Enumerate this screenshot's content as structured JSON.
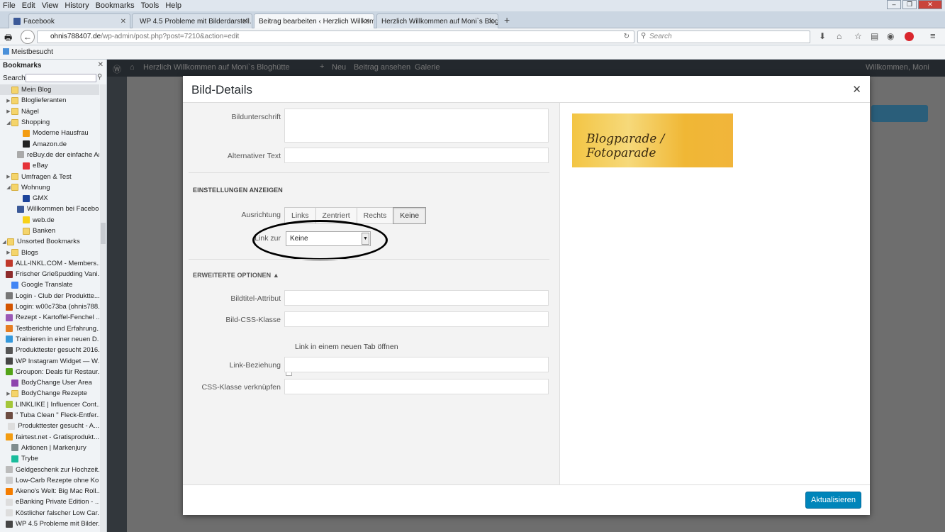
{
  "browser": {
    "menu": [
      "File",
      "Edit",
      "View",
      "History",
      "Bookmarks",
      "Tools",
      "Help"
    ],
    "tabs": [
      "Facebook",
      "WP 4.5 Probleme mit Bilderdarstell...",
      "Beitrag bearbeiten ‹ Herzlich Willkomm...",
      "Herzlich Willkommen auf Moni`s Blog..."
    ],
    "url_domain": "ohnis788407.de",
    "url_path": "/wp-admin/post.php?post=7210&action=edit",
    "search_placeholder": "Search",
    "bookmarks_toolbar": "Meistbesucht"
  },
  "sidebar": {
    "title": "Bookmarks",
    "search_label": "Search:",
    "items": [
      {
        "label": "Mein Blog",
        "icon": "folder",
        "depth": 0,
        "twisty": ""
      },
      {
        "label": "Bloglieferanten",
        "icon": "folder",
        "depth": 0,
        "twisty": "▶"
      },
      {
        "label": "Nägel",
        "icon": "folder",
        "depth": 0,
        "twisty": "▶"
      },
      {
        "label": "Shopping",
        "icon": "folder",
        "depth": 0,
        "twisty": "◢"
      },
      {
        "label": "Moderne Hausfrau",
        "icon": "site",
        "color": "#f39c12",
        "depth": 1
      },
      {
        "label": "Amazon.de",
        "icon": "site",
        "color": "#222",
        "depth": 1
      },
      {
        "label": "reBuy.de der einfache An...",
        "icon": "site",
        "color": "#aaa",
        "depth": 1
      },
      {
        "label": "eBay",
        "icon": "site",
        "color": "#e53238",
        "depth": 1
      },
      {
        "label": "Umfragen & Test",
        "icon": "folder",
        "depth": 0,
        "twisty": "▶"
      },
      {
        "label": "Wohnung",
        "icon": "folder",
        "depth": 0,
        "twisty": "◢"
      },
      {
        "label": "GMX",
        "icon": "site",
        "color": "#1c449b",
        "depth": 1
      },
      {
        "label": "Willkommen bei Facebo...",
        "icon": "site",
        "color": "#3b5998",
        "depth": 1
      },
      {
        "label": "web.de",
        "icon": "site",
        "color": "#f7d117",
        "depth": 1
      },
      {
        "label": "Banken",
        "icon": "folder",
        "depth": 1
      },
      {
        "label": "Unsorted Bookmarks",
        "icon": "folder",
        "depth": -1,
        "twisty": "◢"
      },
      {
        "label": "Blogs",
        "icon": "folder",
        "depth": 0,
        "twisty": "▶"
      },
      {
        "label": "ALL-INKL.COM - Members...",
        "icon": "site",
        "color": "#c0392b",
        "depth": 0
      },
      {
        "label": "Frischer Grießpudding Vani...",
        "icon": "site",
        "color": "#8e2b2b",
        "depth": 0
      },
      {
        "label": "Google Translate",
        "icon": "site",
        "color": "#4285f4",
        "depth": 0
      },
      {
        "label": "Login - Club der Produktte...",
        "icon": "site",
        "color": "#777",
        "depth": 0
      },
      {
        "label": "Login: w00c73ba (ohnis788...",
        "icon": "site",
        "color": "#d35400",
        "depth": 0
      },
      {
        "label": "Rezept - Kartoffel-Fenchel ...",
        "icon": "site",
        "color": "#9b59b6",
        "depth": 0
      },
      {
        "label": "Testberichte und Erfahrung...",
        "icon": "site",
        "color": "#e67e22",
        "depth": 0
      },
      {
        "label": "Trainieren in einer neuen D...",
        "icon": "site",
        "color": "#3498db",
        "depth": 0
      },
      {
        "label": "Produkttester gesucht 2016...",
        "icon": "site",
        "color": "#555",
        "depth": 0
      },
      {
        "label": "WP Instagram Widget — W...",
        "icon": "site",
        "color": "#464646",
        "depth": 0
      },
      {
        "label": "Groupon: Deals für Restaur...",
        "icon": "site",
        "color": "#53a318",
        "depth": 0
      },
      {
        "label": "BodyChange User Area",
        "icon": "site",
        "color": "#8e44ad",
        "depth": 0
      },
      {
        "label": "BodyChange Rezepte",
        "icon": "folder",
        "depth": 0,
        "twisty": "▶"
      },
      {
        "label": "LINKLIKE | Influencer Cont...",
        "icon": "site",
        "color": "#a4c639",
        "depth": 0
      },
      {
        "label": "\" Tuba Clean \" Fleck-Entfer...",
        "icon": "site",
        "color": "#6d4c41",
        "depth": 0
      },
      {
        "label": "Produkttester gesucht - A...",
        "icon": "site",
        "color": "#ddd",
        "depth": 0
      },
      {
        "label": "fairtest.net - Gratisprodukt...",
        "icon": "site",
        "color": "#f39c12",
        "depth": 0
      },
      {
        "label": "Aktionen | Markenjury",
        "icon": "site",
        "color": "#7f8c8d",
        "depth": 0
      },
      {
        "label": "Trybe",
        "icon": "site",
        "color": "#1abc9c",
        "depth": 0
      },
      {
        "label": "Geldgeschenk zur Hochzeit...",
        "icon": "site",
        "color": "#bbb",
        "depth": 0
      },
      {
        "label": "Low-Carb Rezepte ohne Ko...",
        "icon": "site",
        "color": "#ccc",
        "depth": 0
      },
      {
        "label": "Akeno's Welt: Big Mac Roll...",
        "icon": "site",
        "color": "#f57d00",
        "depth": 0
      },
      {
        "label": "eBanking Private Edition - ...",
        "icon": "site",
        "color": "#ddd",
        "depth": 0
      },
      {
        "label": "Köstlicher falscher Low Car...",
        "icon": "site",
        "color": "#ddd",
        "depth": 0
      },
      {
        "label": "WP 4.5 Probleme mit Bilder...",
        "icon": "site",
        "color": "#464646",
        "depth": 0
      }
    ]
  },
  "wp": {
    "adminbar_site": "Herzlich Willkommen auf Moni`s Bloghütte",
    "adminbar_new": "Neu",
    "adminbar_view": "Beitrag ansehen",
    "adminbar_gallery": "Galerie",
    "adminbar_user": "Willkommen, Moni"
  },
  "modal": {
    "title": "Bild-Details",
    "caption_label": "Bildunterschrift",
    "alt_label": "Alternativer Text",
    "display_section": "EINSTELLUNGEN ANZEIGEN",
    "align_label": "Ausrichtung",
    "align_options": [
      "Links",
      "Zentriert",
      "Rechts",
      "Keine"
    ],
    "align_selected": "Keine",
    "link_label": "Link zur",
    "link_value": "Keine",
    "advanced_section": "ERWEITERTE OPTIONEN",
    "title_attr_label": "Bildtitel-Attribut",
    "css_class_label": "Bild-CSS-Klasse",
    "new_tab_label": "Link in einem neuen Tab öffnen",
    "rel_label": "Link-Beziehung",
    "link_css_label": "CSS-Klasse verknüpfen",
    "image_text": "Blogparade / Fotoparade",
    "update_button": "Aktualisieren"
  }
}
